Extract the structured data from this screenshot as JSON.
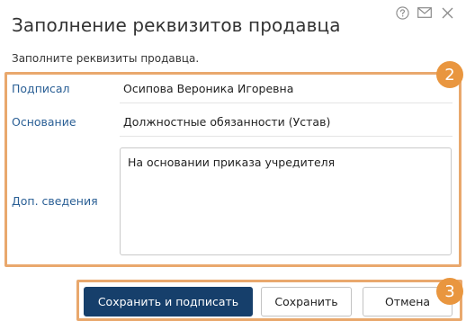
{
  "dialog": {
    "title": "Заполнение реквизитов продавца",
    "subtitle": "Заполните реквизиты продавца.",
    "header_icons": [
      "help-icon",
      "mail-icon",
      "close-icon"
    ]
  },
  "fields": {
    "signed_by": {
      "label": "Подписал",
      "value": "Осипова Вероника Игоревна"
    },
    "basis": {
      "label": "Основание",
      "value": "Должностные обязанности (Устав)"
    },
    "additional": {
      "label": "Доп. сведения",
      "value": "На основании приказа учредителя"
    }
  },
  "buttons": {
    "save_and_sign": "Сохранить и подписать",
    "save": "Сохранить",
    "cancel": "Отмена"
  },
  "annotations": {
    "step_fields": "2",
    "step_buttons": "3",
    "highlight_color": "#e9a86d",
    "badge_color": "#e9963f"
  },
  "colors": {
    "primary_button": "#163f6b",
    "label_text": "#2a5f95"
  }
}
